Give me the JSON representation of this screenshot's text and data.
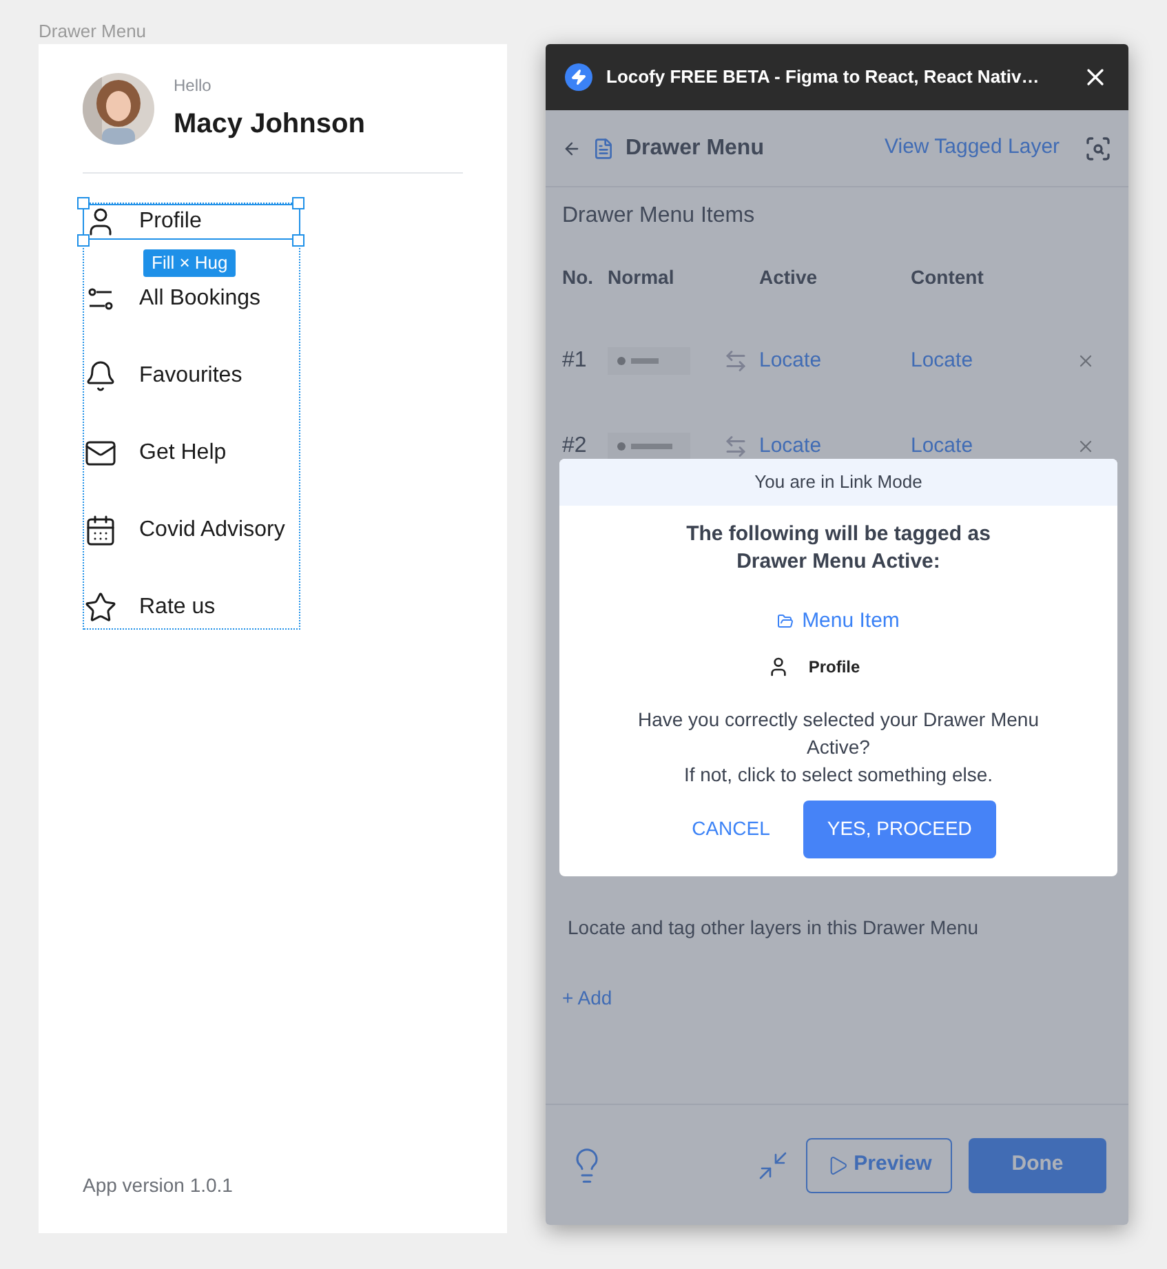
{
  "canvas": {
    "frame_label": "Drawer Menu"
  },
  "drawer": {
    "greeting": "Hello",
    "user_name": "Macy Johnson",
    "selection_badge": "Fill × Hug",
    "app_version": "App version 1.0.1",
    "menu_items": [
      {
        "label": "Profile",
        "kind": "user",
        "selected": true
      },
      {
        "label": "All Bookings",
        "kind": "sliders",
        "selected": false
      },
      {
        "label": "Favourites",
        "kind": "bell",
        "selected": false
      },
      {
        "label": "Get Help",
        "kind": "mail",
        "selected": false
      },
      {
        "label": "Covid Advisory",
        "kind": "calendar",
        "selected": false
      },
      {
        "label": "Rate us",
        "kind": "star",
        "selected": false
      }
    ]
  },
  "plugin": {
    "title": "Locofy FREE BETA - Figma to React, React Nativ…",
    "header": {
      "title": "Drawer Menu",
      "link": "View Tagged Layer"
    },
    "section_title": "Drawer Menu Items",
    "table": {
      "columns": [
        "No.",
        "Normal",
        "Active",
        "Content"
      ],
      "rows": [
        {
          "number": "#1",
          "active": "Locate",
          "content": "Locate"
        },
        {
          "number": "#2",
          "active": "Locate",
          "content": "Locate"
        }
      ]
    },
    "hint": "Locate and tag other layers in this Drawer Menu",
    "add": "+ Add",
    "footer": {
      "preview": "Preview",
      "done": "Done"
    }
  },
  "dialog": {
    "banner": "You are in Link Mode",
    "heading_lines": [
      "The following will be tagged as",
      "Drawer Menu Active:"
    ],
    "group": "Menu Item",
    "layer": "Profile",
    "question": "Have you correctly selected your Drawer Menu Active?",
    "note": "If not, click to select something else.",
    "buttons": {
      "cancel": "CANCEL",
      "confirm": "YES, PROCEED"
    }
  }
}
